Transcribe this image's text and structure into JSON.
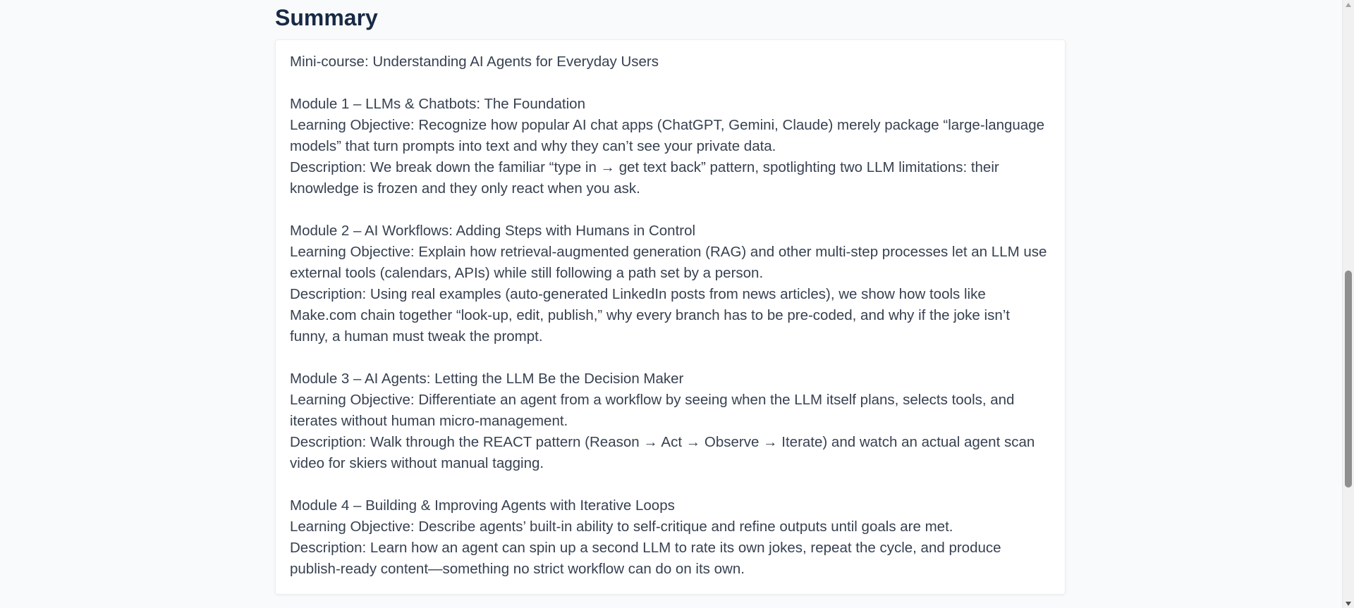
{
  "summary": {
    "title": "Summary",
    "intro": "Mini-course: Understanding AI Agents for Everyday Users",
    "modules": [
      {
        "heading": "Module 1 – LLMs & Chatbots: The Foundation",
        "objective": "Learning Objective: Recognize how popular AI chat apps (ChatGPT, Gemini, Claude) merely package “large-language models” that turn prompts into text and why they can’t see your private data.",
        "description": "Description: We break down the familiar “type in → get text back” pattern, spotlighting two LLM limitations: their knowledge is frozen and they only react when you ask."
      },
      {
        "heading": "Module 2 – AI Workflows: Adding Steps with Humans in Control",
        "objective": "Learning Objective: Explain how retrieval-augmented generation (RAG) and other multi-step processes let an LLM use external tools (calendars, APIs) while still following a path set by a person.",
        "description": "Description: Using real examples (auto-generated LinkedIn posts from news articles), we show how tools like Make.com chain together “look-up, edit, publish,” why every branch has to be pre-coded, and why if the joke isn’t funny, a human must tweak the prompt."
      },
      {
        "heading": "Module 3 – AI Agents: Letting the LLM Be the Decision Maker",
        "objective": "Learning Objective: Differentiate an agent from a workflow by seeing when the LLM itself plans, selects tools, and iterates without human micro-management.",
        "description": "Description: Walk through the REACT pattern (Reason → Act → Observe → Iterate) and watch an actual agent scan video for skiers without manual tagging."
      },
      {
        "heading": "Module 4 – Building & Improving Agents with Iterative Loops",
        "objective": "Learning Objective: Describe agents’ built-in ability to self-critique and refine outputs until goals are met.",
        "description": "Description: Learn how an agent can spin up a second LLM to rate its own jokes, repeat the cycle, and produce publish-ready content—something no strict workflow can do on its own."
      }
    ]
  },
  "scrollbar": {
    "up_icon": "chevron-up-icon",
    "down_icon": "chevron-down-icon"
  }
}
